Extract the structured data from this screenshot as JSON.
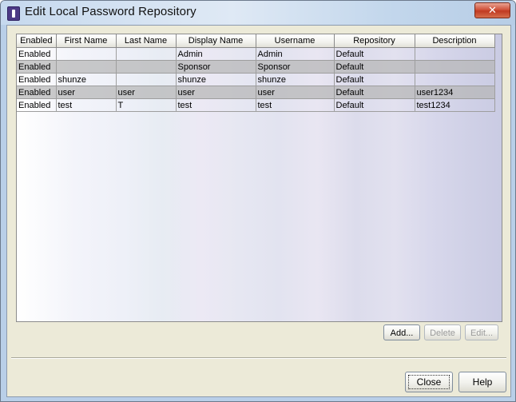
{
  "window": {
    "title": "Edit Local Password Repository",
    "close_glyph": "✕"
  },
  "table": {
    "columns": [
      "Enabled",
      "First Name",
      "Last Name",
      "Display Name",
      "Username",
      "Repository",
      "Description"
    ],
    "rows": [
      [
        "Enabled",
        "",
        "",
        "Admin",
        "Admin",
        "Default",
        ""
      ],
      [
        "Enabled",
        "",
        "",
        "Sponsor",
        "Sponsor",
        "Default",
        ""
      ],
      [
        "Enabled",
        "shunze",
        "",
        "shunze",
        "shunze",
        "Default",
        ""
      ],
      [
        "Enabled",
        "user",
        "user",
        "user",
        "user",
        "Default",
        "user1234"
      ],
      [
        "Enabled",
        "test",
        "T",
        "test",
        "test",
        "Default",
        "test1234"
      ]
    ]
  },
  "buttons": {
    "add": "Add...",
    "delete": "Delete",
    "edit": "Edit...",
    "close": "Close",
    "help": "Help"
  },
  "colors": {
    "titlebar": "#c6d9ee",
    "dialog_bg": "#ecead8",
    "alt_row": "#b6b6b6"
  }
}
